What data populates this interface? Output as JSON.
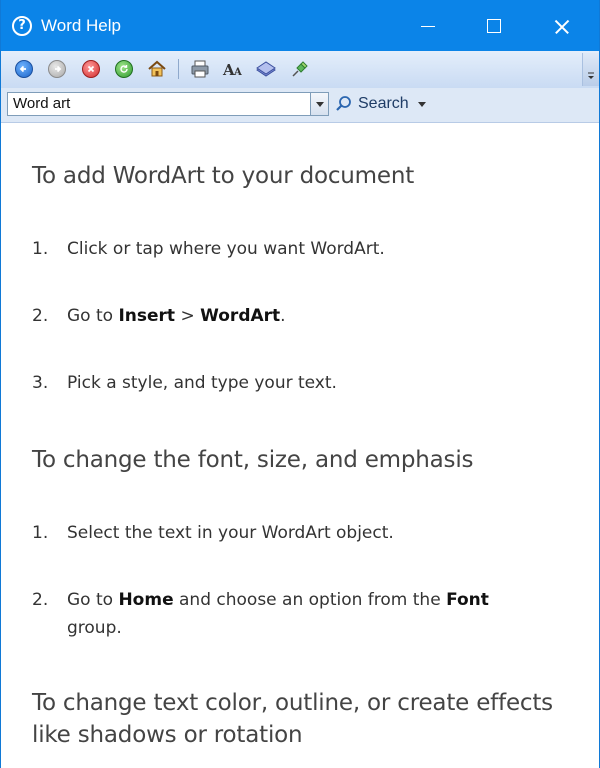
{
  "window": {
    "title": "Word Help"
  },
  "toolbar": {
    "buttons": [
      {
        "name": "back-icon"
      },
      {
        "name": "forward-icon"
      },
      {
        "name": "stop-icon"
      },
      {
        "name": "refresh-icon"
      },
      {
        "name": "home-icon"
      },
      {
        "name": "print-icon"
      },
      {
        "name": "text-size-icon"
      },
      {
        "name": "table-of-contents-icon"
      },
      {
        "name": "keep-on-top-pin-icon"
      }
    ]
  },
  "search": {
    "value": "Word art",
    "button_label": "Search"
  },
  "article": {
    "section1": {
      "heading": "To add WordArt to your document",
      "steps": [
        {
          "num": "1.",
          "before": "Click or tap where you want WordArt.",
          "b1": "",
          "mid": "",
          "b2": "",
          "after": ""
        },
        {
          "num": "2.",
          "before": "Go to ",
          "b1": "Insert",
          "mid": " > ",
          "b2": "WordArt",
          "after": "."
        },
        {
          "num": "3.",
          "before": "Pick a style, and type your text.",
          "b1": "",
          "mid": "",
          "b2": "",
          "after": ""
        }
      ]
    },
    "section2": {
      "heading": "To change the font, size, and emphasis",
      "steps": [
        {
          "num": "1.",
          "before": "Select the text in your WordArt object.",
          "b1": "",
          "mid": "",
          "b2": "",
          "after": ""
        },
        {
          "num": "2.",
          "before": "Go to ",
          "b1": "Home",
          "mid": " and choose an option from the ",
          "b2": "Font",
          "after": " group."
        }
      ]
    },
    "section3": {
      "heading_line1": "To change text color, outline, or create effects",
      "heading_line2": "like shadows or rotation"
    }
  },
  "colors": {
    "titlebar": "#0b84e8",
    "toolbar": "#d3e2f6"
  }
}
